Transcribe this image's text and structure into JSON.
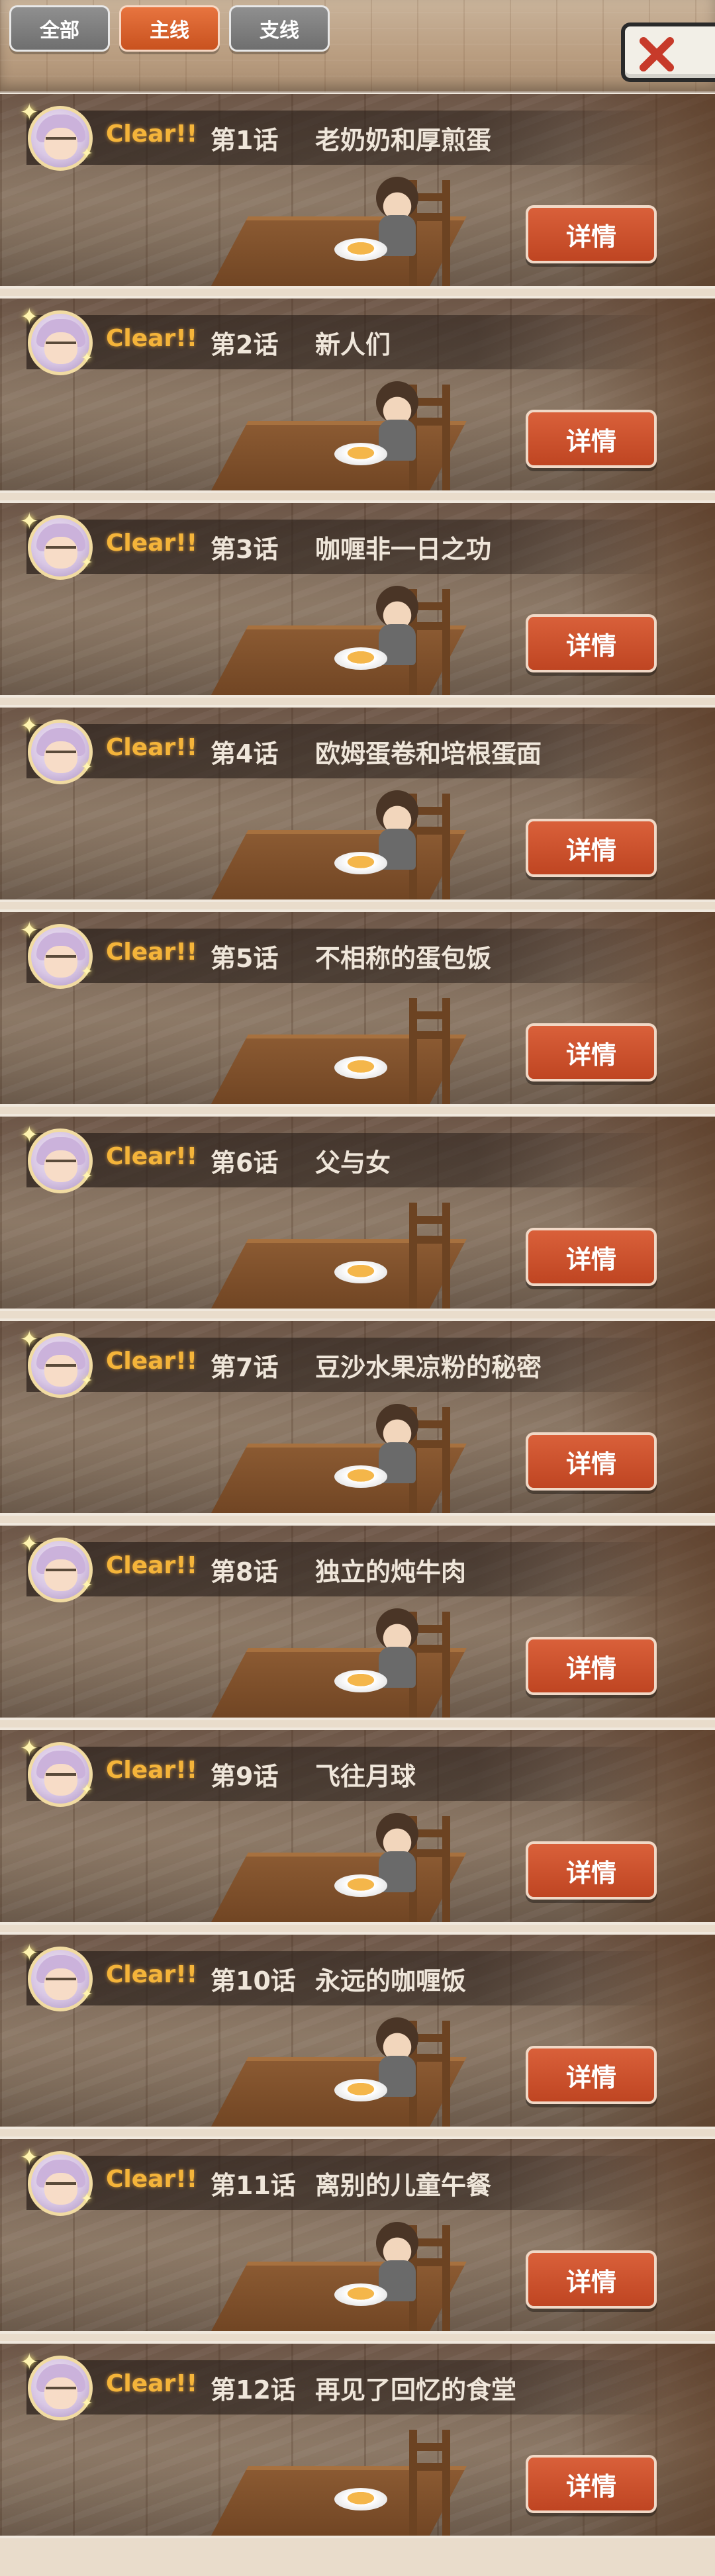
{
  "tabs": [
    {
      "label": "全部",
      "state": "inactive"
    },
    {
      "label": "主线",
      "state": "active"
    },
    {
      "label": "支线",
      "state": "inactive"
    }
  ],
  "close_button": {
    "icon": "close-icon"
  },
  "episodes": [
    {
      "status": "Clear!!",
      "number": "第1话",
      "title": "老奶奶和厚煎蛋",
      "button": "详情",
      "has_character": true
    },
    {
      "status": "Clear!!",
      "number": "第2话",
      "title": "新人们",
      "button": "详情",
      "has_character": true
    },
    {
      "status": "Clear!!",
      "number": "第3话",
      "title": "咖喱非一日之功",
      "button": "详情",
      "has_character": true
    },
    {
      "status": "Clear!!",
      "number": "第4话",
      "title": "欧姆蛋卷和培根蛋面",
      "button": "详情",
      "has_character": true
    },
    {
      "status": "Clear!!",
      "number": "第5话",
      "title": "不相称的蛋包饭",
      "button": "详情",
      "has_character": false
    },
    {
      "status": "Clear!!",
      "number": "第6话",
      "title": "父与女",
      "button": "详情",
      "has_character": false
    },
    {
      "status": "Clear!!",
      "number": "第7话",
      "title": "豆沙水果凉粉的秘密",
      "button": "详情",
      "has_character": true
    },
    {
      "status": "Clear!!",
      "number": "第8话",
      "title": "独立的炖牛肉",
      "button": "详情",
      "has_character": true
    },
    {
      "status": "Clear!!",
      "number": "第9话",
      "title": "飞往月球",
      "button": "详情",
      "has_character": true
    },
    {
      "status": "Clear!!",
      "number": "第10话",
      "title": "永远的咖喱饭",
      "button": "详情",
      "has_character": true
    },
    {
      "status": "Clear!!",
      "number": "第11话",
      "title": "离别的儿童午餐",
      "button": "详情",
      "has_character": true
    },
    {
      "status": "Clear!!",
      "number": "第12话",
      "title": "再见了回忆的食堂",
      "button": "详情",
      "has_character": false
    }
  ],
  "colors": {
    "active_tab": "#d9603a",
    "inactive_tab": "#7f7f7f",
    "detail_button": "#cc522c",
    "clear_text": "#f4b43a",
    "title_text": "#efe6da"
  }
}
